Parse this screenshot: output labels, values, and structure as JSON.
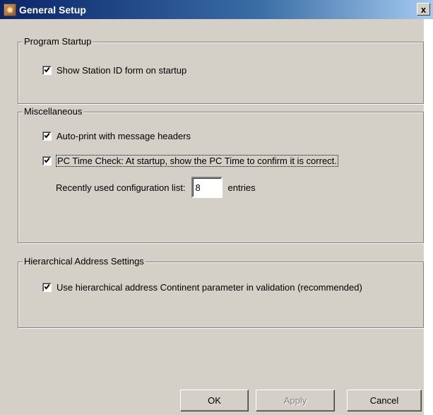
{
  "window": {
    "title": "General Setup",
    "close_label": "x"
  },
  "program_startup": {
    "legend": "Program Startup",
    "show_station_id": {
      "label": "Show Station ID form on startup",
      "checked": true
    }
  },
  "miscellaneous": {
    "legend": "Miscellaneous",
    "auto_print": {
      "label": "Auto-print with message headers",
      "checked": true
    },
    "pc_time_check": {
      "label": "PC Time Check: At startup, show the PC Time to confirm it is correct.",
      "checked": true
    },
    "recent_list": {
      "label": "Recently used configuration list:",
      "value": "8",
      "suffix": "entries"
    }
  },
  "hierarchical": {
    "legend": "Hierarchical Address Settings",
    "use_continent": {
      "label": "Use hierarchical address Continent parameter in validation (recommended)",
      "checked": true
    }
  },
  "buttons": {
    "ok": "OK",
    "apply": "Apply",
    "cancel": "Cancel"
  }
}
